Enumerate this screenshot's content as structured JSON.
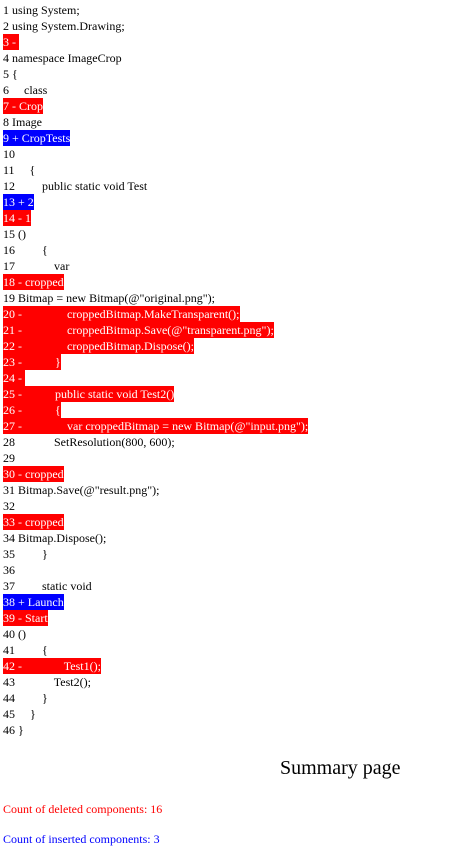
{
  "colors": {
    "deleted_bg": "#ff0000",
    "inserted_bg": "#0000ff",
    "deleted_text": "#ff0000",
    "inserted_text": "#0000ff"
  },
  "lines": [
    {
      "type": "ctx",
      "text": "1 using System;"
    },
    {
      "type": "ctx",
      "text": "2 using System.Drawing;"
    },
    {
      "type": "del",
      "text": "3 - "
    },
    {
      "type": "ctx",
      "text": "4 namespace ImageCrop"
    },
    {
      "type": "ctx",
      "text": "5 {"
    },
    {
      "type": "ctx",
      "text": "6     class"
    },
    {
      "type": "del",
      "text": "7 - Crop"
    },
    {
      "type": "ctx",
      "text": "8 Image"
    },
    {
      "type": "ins",
      "text": "9 + CropTests"
    },
    {
      "type": "ctx",
      "text": "10"
    },
    {
      "type": "ctx",
      "text": "11     {"
    },
    {
      "type": "ctx",
      "text": "12         public static void Test"
    },
    {
      "type": "ins",
      "text": "13 + 2"
    },
    {
      "type": "del",
      "text": "14 - 1"
    },
    {
      "type": "ctx",
      "text": "15 ()"
    },
    {
      "type": "ctx",
      "text": "16         {"
    },
    {
      "type": "ctx",
      "text": "17             var"
    },
    {
      "type": "del",
      "text": "18 - cropped"
    },
    {
      "type": "ctx",
      "text": "19 Bitmap = new Bitmap(@\"original.png\");"
    },
    {
      "type": "del",
      "text": "20 -               croppedBitmap.MakeTransparent();"
    },
    {
      "type": "del",
      "text": "21 -               croppedBitmap.Save(@\"transparent.png\");"
    },
    {
      "type": "del",
      "text": "22 -               croppedBitmap.Dispose();"
    },
    {
      "type": "del",
      "text": "23 -           }"
    },
    {
      "type": "del",
      "text": "24 - "
    },
    {
      "type": "del",
      "text": "25 -           public static void Test2()"
    },
    {
      "type": "del",
      "text": "26 -           {"
    },
    {
      "type": "del",
      "text": "27 -               var croppedBitmap = new Bitmap(@\"input.png\");"
    },
    {
      "type": "ctx",
      "text": "28             SetResolution(800, 600);"
    },
    {
      "type": "ctx",
      "text": "29"
    },
    {
      "type": "del",
      "text": "30 - cropped"
    },
    {
      "type": "ctx",
      "text": "31 Bitmap.Save(@\"result.png\");"
    },
    {
      "type": "ctx",
      "text": "32"
    },
    {
      "type": "del",
      "text": "33 - cropped"
    },
    {
      "type": "ctx",
      "text": "34 Bitmap.Dispose();"
    },
    {
      "type": "ctx",
      "text": "35         }"
    },
    {
      "type": "ctx",
      "text": "36"
    },
    {
      "type": "ctx",
      "text": "37         static void"
    },
    {
      "type": "ins",
      "text": "38 + Launch"
    },
    {
      "type": "del",
      "text": "39 - Start"
    },
    {
      "type": "ctx",
      "text": "40 ()"
    },
    {
      "type": "ctx",
      "text": "41         {"
    },
    {
      "type": "del",
      "text": "42 -              Test1();"
    },
    {
      "type": "ctx",
      "text": "43             Test2();"
    },
    {
      "type": "ctx",
      "text": "44         }"
    },
    {
      "type": "ctx",
      "text": "45     }"
    },
    {
      "type": "ctx",
      "text": "46 }"
    }
  ],
  "summary": {
    "title": "Summary page",
    "deleted_label": "Count of deleted components: 16",
    "inserted_label": "Count of inserted components: 3"
  }
}
